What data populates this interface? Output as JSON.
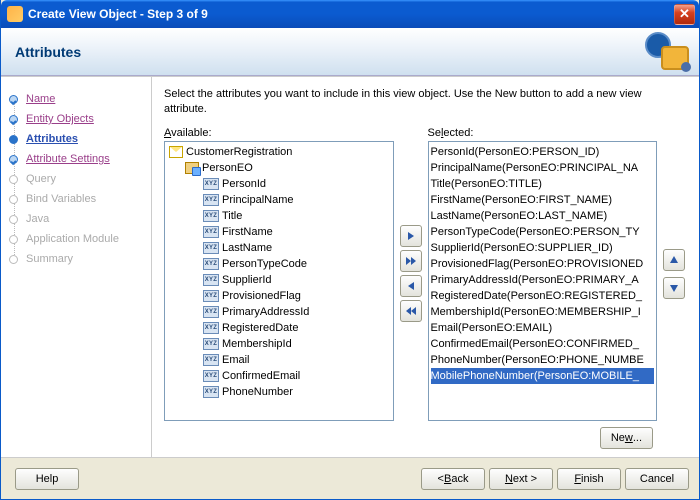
{
  "window": {
    "title": "Create View Object - Step 3 of 9"
  },
  "banner": {
    "title": "Attributes"
  },
  "steps": [
    {
      "label": "Name",
      "state": "done"
    },
    {
      "label": "Entity Objects",
      "state": "done"
    },
    {
      "label": "Attributes",
      "state": "active"
    },
    {
      "label": "Attribute Settings",
      "state": "done"
    },
    {
      "label": "Query",
      "state": "pending"
    },
    {
      "label": "Bind Variables",
      "state": "pending"
    },
    {
      "label": "Java",
      "state": "pending"
    },
    {
      "label": "Application Module",
      "state": "pending"
    },
    {
      "label": "Summary",
      "state": "pending"
    }
  ],
  "content": {
    "instruction": "Select the attributes you want to include in this view object.  Use the New button to add a new view attribute.",
    "available_label": "Available:",
    "selected_label": "Selected:",
    "available_root": "CustomerRegistration",
    "available_entity": "PersonEO",
    "available_attrs": [
      "PersonId",
      "PrincipalName",
      "Title",
      "FirstName",
      "LastName",
      "PersonTypeCode",
      "SupplierId",
      "ProvisionedFlag",
      "PrimaryAddressId",
      "RegisteredDate",
      "MembershipId",
      "Email",
      "ConfirmedEmail",
      "PhoneNumber"
    ],
    "selected_items": [
      "PersonId(PersonEO:PERSON_ID)",
      "PrincipalName(PersonEO:PRINCIPAL_NA",
      "Title(PersonEO:TITLE)",
      "FirstName(PersonEO:FIRST_NAME)",
      "LastName(PersonEO:LAST_NAME)",
      "PersonTypeCode(PersonEO:PERSON_TY",
      "SupplierId(PersonEO:SUPPLIER_ID)",
      "ProvisionedFlag(PersonEO:PROVISIONED",
      "PrimaryAddressId(PersonEO:PRIMARY_A",
      "RegisteredDate(PersonEO:REGISTERED_",
      "MembershipId(PersonEO:MEMBERSHIP_I",
      "Email(PersonEO:EMAIL)",
      "ConfirmedEmail(PersonEO:CONFIRMED_",
      "PhoneNumber(PersonEO:PHONE_NUMBE",
      "MobilePhoneNumber(PersonEO:MOBILE_"
    ],
    "selected_highlight_index": 14,
    "new_button": "New..."
  },
  "footer": {
    "help": "Help",
    "back": "< Back",
    "next": "Next >",
    "finish": "Finish",
    "cancel": "Cancel"
  }
}
